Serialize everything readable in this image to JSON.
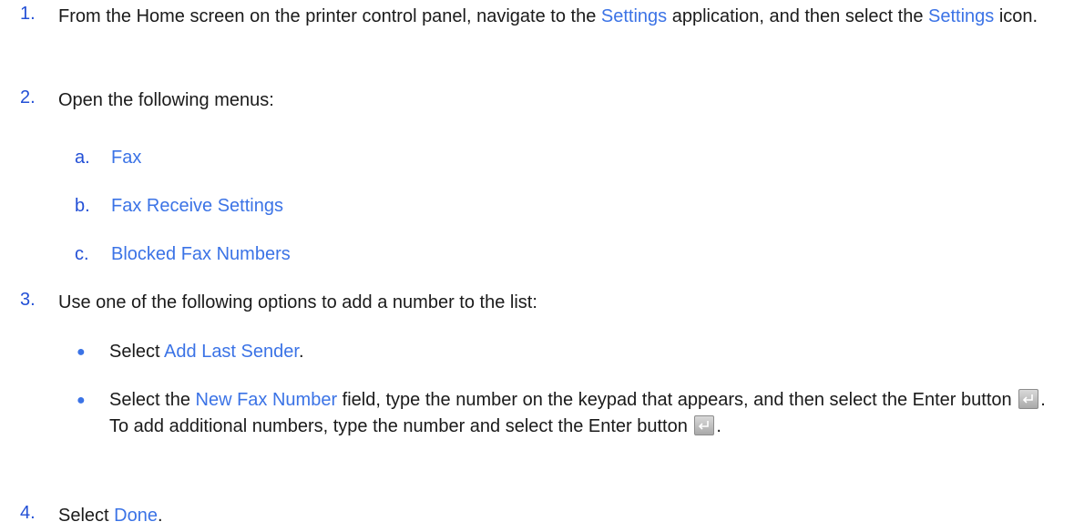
{
  "steps": [
    {
      "num": "1.",
      "parts": [
        "From the Home screen on the printer control panel, navigate to the ",
        "Settings",
        " application, and then select the ",
        "Settings",
        " icon."
      ]
    },
    {
      "num": "2.",
      "text": "Open the following menus:",
      "subs": [
        {
          "num": "a.",
          "text": "Fax"
        },
        {
          "num": "b.",
          "text": "Fax Receive Settings"
        },
        {
          "num": "c.",
          "text": "Blocked Fax Numbers"
        }
      ]
    },
    {
      "num": "3.",
      "text": "Use one of the following options to add a number to the list:",
      "bullets": [
        {
          "parts": [
            "Select ",
            "Add Last Sender",
            "."
          ]
        },
        {
          "parts": [
            "Select the ",
            "New Fax Number",
            " field, type the number on the keypad that appears, and then select the Enter button ",
            ". To add additional numbers, type the number and select the Enter button ",
            "."
          ]
        }
      ]
    },
    {
      "num": "4.",
      "parts": [
        "Select ",
        "Done",
        "."
      ]
    }
  ],
  "bullet_glyph": "●",
  "icons": {
    "enter": "enter-key-icon"
  },
  "colors": {
    "ui_text": "#3b73e6",
    "step_number": "#2350d6",
    "body_text": "#1a1a1a"
  }
}
